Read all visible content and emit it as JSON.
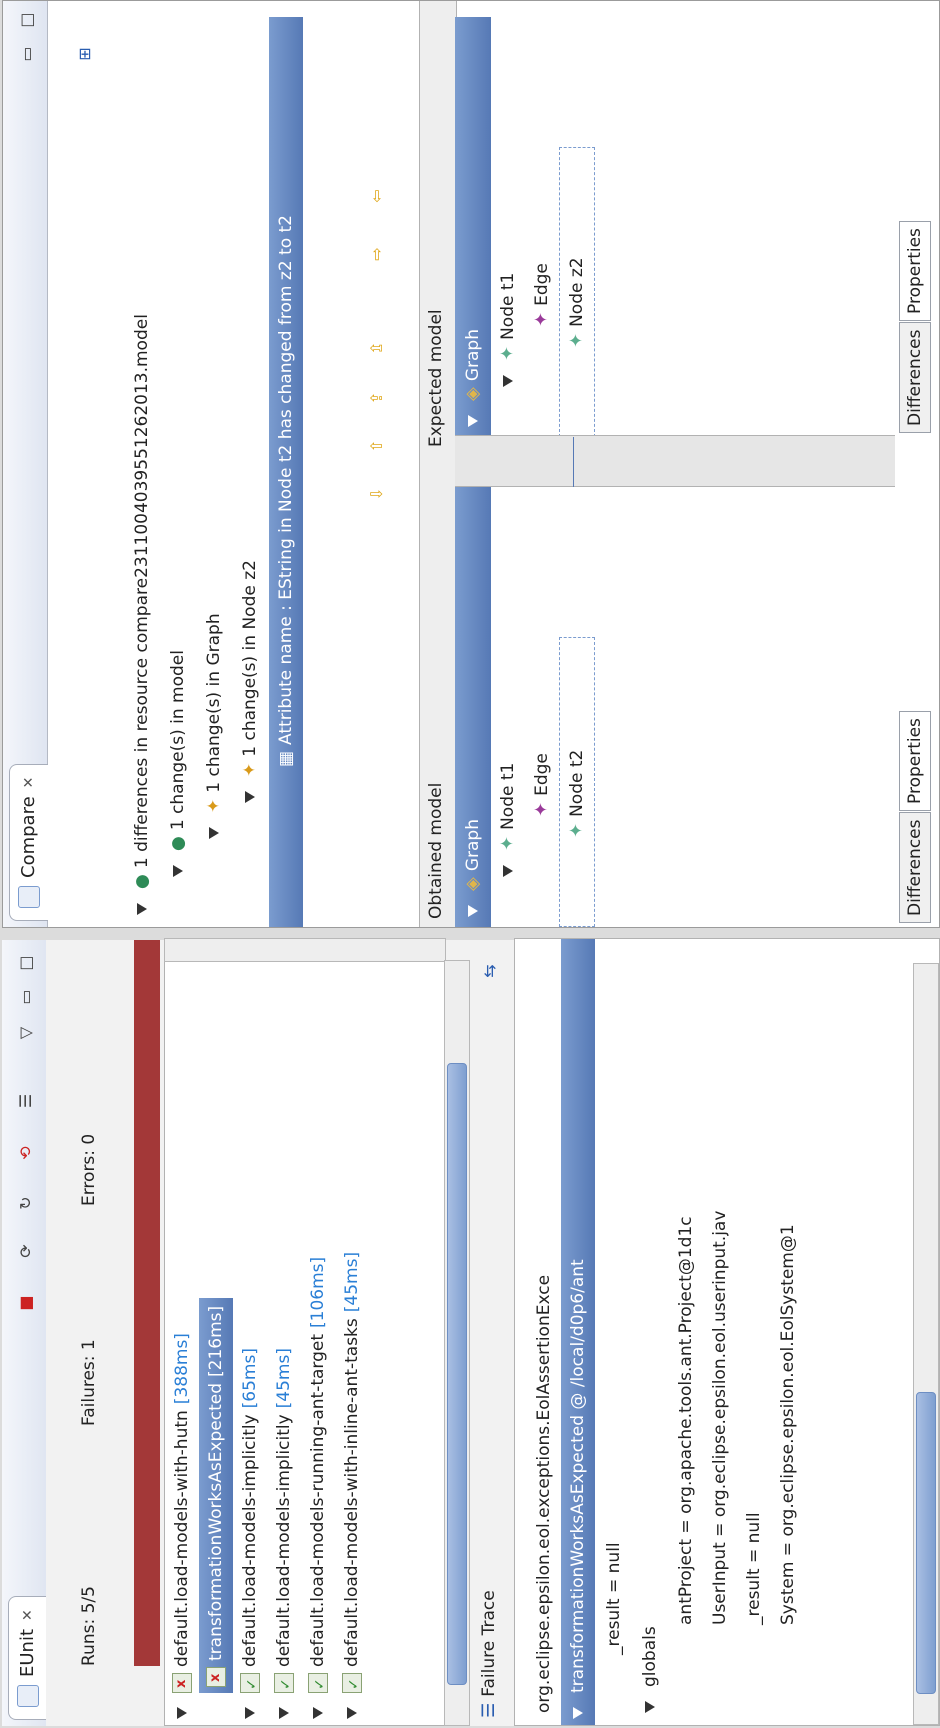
{
  "eunit": {
    "tab_title": "EUnit",
    "runs": "Runs:  5/5",
    "failures": "Failures:  1",
    "errors": "Errors:  0",
    "status_color": "#a33838",
    "tests": [
      {
        "name": "default.load-models-with-hutn",
        "time": "[388ms]",
        "status": "error",
        "expanded": true
      },
      {
        "name": "transformationWorksAsExpected",
        "time": "[216ms]",
        "status": "error",
        "selected": true
      },
      {
        "name": "default.load-models-implicitly",
        "time": "[65ms]",
        "status": "ok"
      },
      {
        "name": "default.load-models-implicitly",
        "time": "[45ms]",
        "status": "ok"
      },
      {
        "name": "default.load-models-running-ant-target",
        "time": "[106ms]",
        "status": "ok"
      },
      {
        "name": "default.load-models-with-inline-ant-tasks",
        "time": "[45ms]",
        "status": "ok"
      }
    ],
    "failure_trace_label": "Failure Trace",
    "trace_exception": "org.eclipse.epsilon.eol.exceptions.EolAssertionExce",
    "trace_frame": "transformationWorksAsExpected @ /local/d0p6/ant",
    "trace_vars": [
      "_result = null",
      "globals",
      "antProject = org.apache.tools.ant.Project@1d1c",
      "UserInput = org.eclipse.epsilon.eol.userinput.jav",
      "_result = null",
      "System = org.eclipse.epsilon.eol.EolSystem@1"
    ]
  },
  "compare": {
    "tab_title": "Compare",
    "summary": "1 differences in resource compare23110040395512620​13.model",
    "tree": [
      "1 change(s) in model",
      "1 change(s) in Graph",
      "1 change(s) in Node z2",
      "Attribute name : EString in Node t2 has changed from z2 to t2"
    ],
    "obtained_label": "Obtained model",
    "expected_label": "Expected model",
    "obtained_tree": [
      "Graph",
      "Node t1",
      "Edge",
      "Node t2"
    ],
    "expected_tree": [
      "Graph",
      "Node t1",
      "Edge",
      "Node z2"
    ],
    "bottom_tabs": [
      "Differences",
      "Properties"
    ],
    "accent": "#5679b5"
  }
}
